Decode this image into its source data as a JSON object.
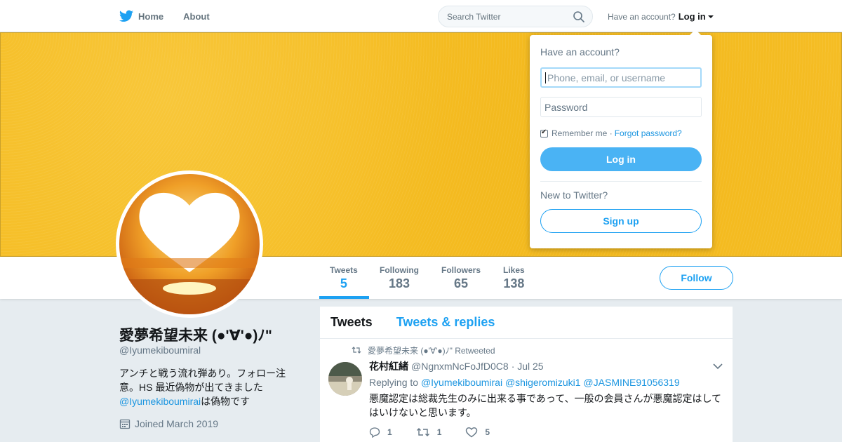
{
  "nav": {
    "home_label": "Home",
    "about_label": "About",
    "search_placeholder": "Search Twitter",
    "have_account": "Have an account?",
    "login_label": "Log in"
  },
  "colors": {
    "twitter_blue": "#1da1f2",
    "banner_yellow": "#f5bd24",
    "link": "#1b95e0"
  },
  "profile": {
    "name": "愛夢希望未来 (●'∀'●)ﾉ\"",
    "handle": "@Iyumekiboumiral",
    "bio_line": "アンチと戦う流れ弾あり。フォロー注意。HS 最近偽物が出てきました",
    "bio_link": "@Iyumekiboumirai",
    "bio_tail": "は偽物です",
    "joined": "Joined March 2019"
  },
  "stats": [
    {
      "label": "Tweets",
      "value": "5"
    },
    {
      "label": "Following",
      "value": "183"
    },
    {
      "label": "Followers",
      "value": "65"
    },
    {
      "label": "Likes",
      "value": "138"
    }
  ],
  "follow_label": "Follow",
  "timeline": {
    "tabs": [
      "Tweets",
      "Tweets & replies"
    ],
    "tweet": {
      "retweeted_by": "愛夢希望未来 (●'∀'●)ﾉ\" Retweeted",
      "author_name": "花村紅緒",
      "author_handle": "@NgnxmNcFoJfD0C8",
      "date": "· Jul 25",
      "replying_prefix": "Replying to",
      "replying_to": "@Iyumekiboumirai @shigeromizuki1 @JASMINE91056319",
      "text": "悪魔認定は総裁先生のみに出来る事であって、一般の会員さんが悪魔認定はしてはいけないと思います。",
      "replies": "1",
      "retweets": "1",
      "likes": "5"
    }
  },
  "login_dropdown": {
    "title": "Have an account?",
    "username_placeholder": "Phone, email, or username",
    "password_placeholder": "Password",
    "remember_label": "Remember me ·",
    "forgot_label": "Forgot password?",
    "login_button": "Log in",
    "new_label": "New to Twitter?",
    "signup_button": "Sign up"
  }
}
